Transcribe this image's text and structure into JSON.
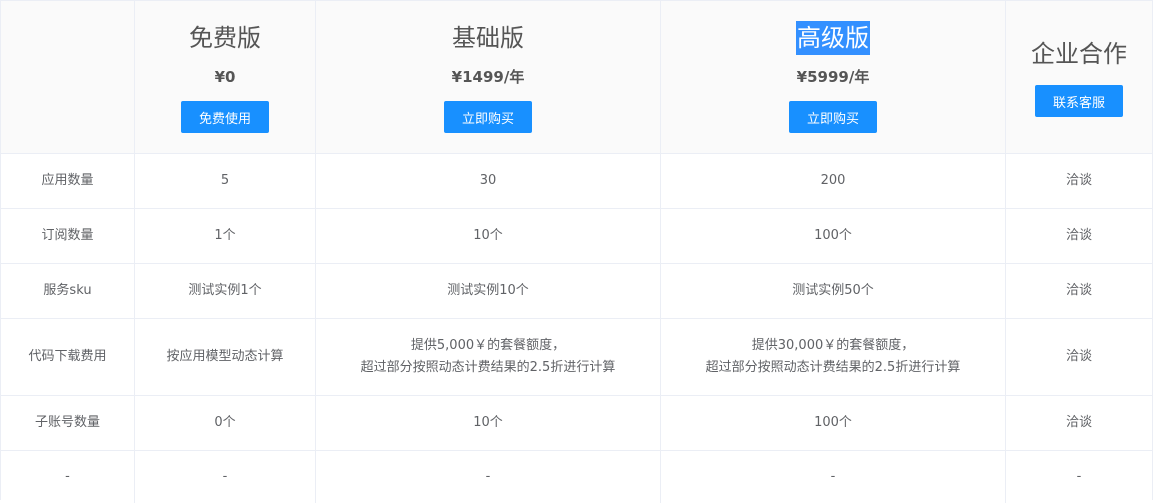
{
  "plans": [
    {
      "name": "免费版",
      "price": "¥0",
      "button": "免费使用",
      "highlight": false
    },
    {
      "name": "基础版",
      "price": "¥1499/年",
      "button": "立即购买",
      "highlight": false
    },
    {
      "name": "高级版",
      "price": "¥5999/年",
      "button": "立即购买",
      "highlight": true
    },
    {
      "name": "企业合作",
      "price": "",
      "button": "联系客服",
      "highlight": false
    }
  ],
  "rows": [
    {
      "label": "应用数量",
      "values": [
        "5",
        "30",
        "200",
        "洽谈"
      ]
    },
    {
      "label": "订阅数量",
      "values": [
        "1个",
        "10个",
        "100个",
        "洽谈"
      ]
    },
    {
      "label": "服务sku",
      "values": [
        "测试实例1个",
        "测试实例10个",
        "测试实例50个",
        "洽谈"
      ]
    },
    {
      "label": "代码下载费用",
      "values": [
        "按应用模型动态计算",
        "提供5,000￥的套餐额度，\n超过部分按照动态计费结果的2.5折进行计算",
        "提供30,000￥的套餐额度，\n超过部分按照动态计费结果的2.5折进行计算",
        "洽谈"
      ]
    },
    {
      "label": "子账号数量",
      "values": [
        "0个",
        "10个",
        "100个",
        "洽谈"
      ]
    },
    {
      "label": "-",
      "values": [
        "-",
        "-",
        "-",
        "-"
      ]
    }
  ],
  "colors": {
    "accent": "#1890ff",
    "highlight_bg": "#3390ff",
    "border": "#ebeef5",
    "header_bg": "#fafafa",
    "text": "#606266"
  }
}
